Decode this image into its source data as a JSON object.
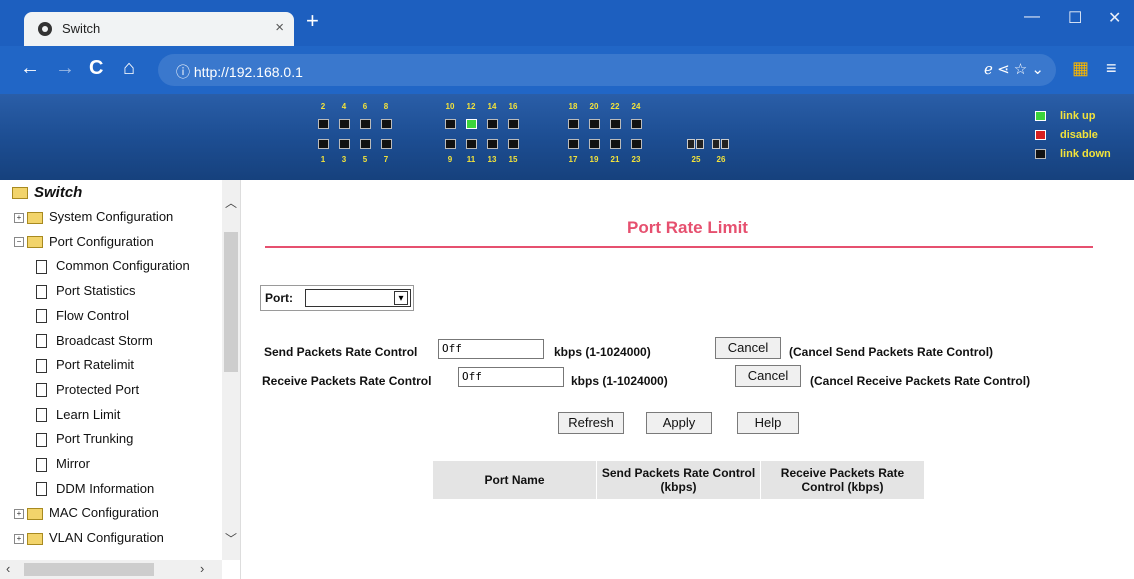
{
  "browser": {
    "tab_title": "Switch",
    "tab_close": "×",
    "new_tab": "+",
    "url": "192.168.0.1",
    "url_scheme": "http://",
    "info_icon": "ⓘ",
    "url_icons": "ℯ ⋖ ☆ ⌄",
    "ext_icon": "▦",
    "menu_icon": "≡",
    "back": "←",
    "forward": "→",
    "reload": "C",
    "home": "⌂",
    "minimize": "—",
    "maximize": "☐",
    "close": "✕"
  },
  "banner": {
    "top_ports": [
      "2",
      "4",
      "6",
      "8",
      "10",
      "12",
      "14",
      "16",
      "18",
      "20",
      "22",
      "24"
    ],
    "bottom_ports": [
      "1",
      "3",
      "5",
      "7",
      "9",
      "11",
      "13",
      "15",
      "17",
      "19",
      "21",
      "23"
    ],
    "sfp_ports": [
      "25",
      "26"
    ],
    "link_up_port": "12",
    "legend": {
      "up": "link up",
      "disable": "disable",
      "down": "link down"
    },
    "colors": {
      "up": "#3bd43b",
      "disable": "#d62020",
      "down": "#111111",
      "label": "#f3e33a"
    }
  },
  "sidebar": {
    "root": "Switch",
    "items": [
      {
        "label": "System Configuration",
        "type": "folder",
        "expanded": false
      },
      {
        "label": "Port Configuration",
        "type": "folder",
        "expanded": true
      },
      {
        "label": "Common Configuration",
        "type": "doc"
      },
      {
        "label": "Port Statistics",
        "type": "doc"
      },
      {
        "label": "Flow Control",
        "type": "doc"
      },
      {
        "label": "Broadcast Storm",
        "type": "doc"
      },
      {
        "label": "Port Ratelimit",
        "type": "doc"
      },
      {
        "label": "Protected Port",
        "type": "doc"
      },
      {
        "label": "Learn Limit",
        "type": "doc"
      },
      {
        "label": "Port Trunking",
        "type": "doc"
      },
      {
        "label": "Mirror",
        "type": "doc"
      },
      {
        "label": "DDM Information",
        "type": "doc"
      },
      {
        "label": "MAC Configuration",
        "type": "folder",
        "expanded": false
      },
      {
        "label": "VLAN Configuration",
        "type": "folder",
        "expanded": false
      }
    ]
  },
  "main": {
    "title": "Port Rate Limit",
    "port_label": "Port:",
    "port_value": "",
    "send_label": "Send Packets Rate Control",
    "send_value": "Off",
    "send_unit": "kbps (1-1024000)",
    "send_cancel": "Cancel",
    "send_cancel_note": "(Cancel Send Packets Rate Control)",
    "recv_label": "Receive Packets Rate Control",
    "recv_value": "Off",
    "recv_unit": "kbps (1-1024000)",
    "recv_cancel": "Cancel",
    "recv_cancel_note": "(Cancel Receive Packets Rate Control)",
    "refresh": "Refresh",
    "apply": "Apply",
    "help": "Help",
    "table_headers": [
      "Port Name",
      "Send Packets Rate Control (kbps)",
      "Receive Packets Rate Control (kbps)"
    ]
  }
}
